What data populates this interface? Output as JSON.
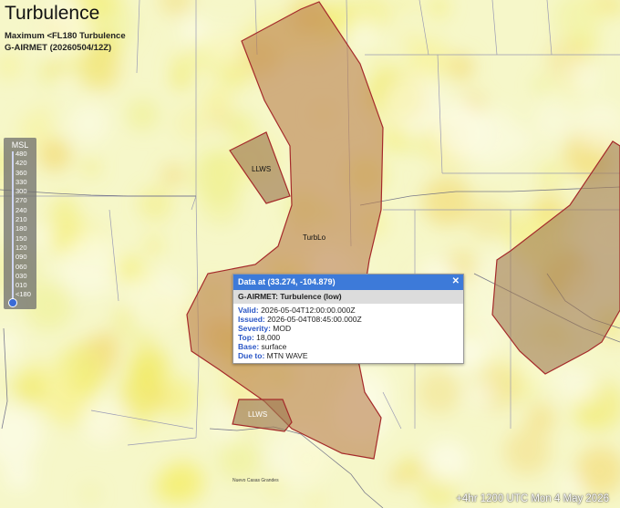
{
  "header": {
    "title": "Turbulence",
    "subtitle_line1": "Maximum <FL180 Turbulence",
    "subtitle_line2": "G-AIRMET (20260504/12Z)"
  },
  "legend": {
    "title": "MSL",
    "labels": [
      "480",
      "420",
      "360",
      "330",
      "300",
      "270",
      "240",
      "210",
      "180",
      "150",
      "120",
      "090",
      "060",
      "030",
      "010",
      "<180"
    ]
  },
  "popup": {
    "header": "Data at (33.274, -104.879)",
    "close_glyph": "✕",
    "subheader": "G-AIRMET: Turbulence (low)",
    "fields": [
      {
        "key": "Valid:",
        "value": "2026-05-04T12:00:00.000Z"
      },
      {
        "key": "Issued:",
        "value": "2026-05-04T08:45:00.000Z"
      },
      {
        "key": "Severity:",
        "value": "MOD"
      },
      {
        "key": "Top:",
        "value": "18,000"
      },
      {
        "key": "Base:",
        "value": "surface"
      },
      {
        "key": "Due to:",
        "value": "MTN WAVE"
      }
    ]
  },
  "map_labels": {
    "llws_north": "LLWS",
    "turb_label": "TurbLo",
    "llws_south": "LLWS",
    "city_south": "Nuevo Casas Grandes"
  },
  "footer": {
    "valid_time": "+4hr 1200 UTC Mon 4 May 2026"
  },
  "colors": {
    "advisory_fill": "#b97f4e",
    "advisory_stroke": "#a52a2a",
    "popup_header": "#3d7ad9",
    "background_yellow": "#f6f7c9",
    "turbulence_hotspot": "#f4ee6e"
  }
}
